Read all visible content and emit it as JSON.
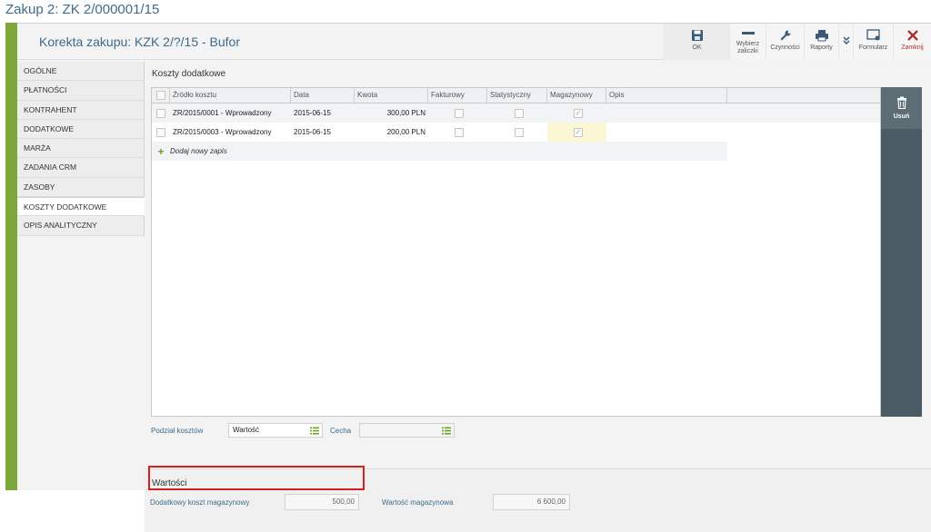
{
  "app": {
    "title": "Zakup 2: ZK 2/000001/15"
  },
  "document": {
    "title": "Korekta zakupu: KZK 2/?/15 - Bufor"
  },
  "toolbar": {
    "ok": "OK",
    "zaliczki_line1": "Wybierz",
    "zaliczki_line2": "zaliczki",
    "czynnosci": "Czynności",
    "raporty": "Raporty",
    "formularz": "Formularz",
    "zamknij": "Zamknij"
  },
  "nav": {
    "items": [
      "OGÓLNE",
      "PŁATNOŚCI",
      "KONTRAHENT",
      "DODATKOWE",
      "MARŻA",
      "ZADANIA CRM",
      "ZASOBY",
      "KOSZTY DODATKOWE",
      "OPIS ANALITYCZNY"
    ],
    "active": "KOSZTY DODATKOWE"
  },
  "section": {
    "title": "Koszty dodatkowe"
  },
  "grid": {
    "columns": [
      "Źródło kosztu",
      "Data",
      "Kwota",
      "Fakturowy",
      "Statystyczny",
      "Magazynowy",
      "Opis"
    ],
    "rows": [
      {
        "source": "ZR/2015/0001 - Wprowadzony",
        "date": "2015-06-15",
        "amount": "300,00 PLN",
        "fakturowy": false,
        "statystyczny": false,
        "magazynowy": true,
        "opis": ""
      },
      {
        "source": "ZR/2015/0003 - Wprowadzony",
        "date": "2015-06-15",
        "amount": "200,00 PLN",
        "fakturowy": false,
        "statystyczny": false,
        "magazynowy": true,
        "opis": ""
      }
    ],
    "add_label": "Dodaj nowy zapis"
  },
  "side": {
    "delete_label": "Usuń"
  },
  "split": {
    "label": "Podział kosztów",
    "value": "Wartość",
    "cecha_label": "Cecha",
    "cecha_value": ""
  },
  "values": {
    "title": "Wartości",
    "extra_cost_label": "Dodatkowy koszt magazynowy",
    "extra_cost_value": "500,00",
    "stock_value_label": "Wartość magazynowa",
    "stock_value_value": "6 600,00"
  },
  "colors": {
    "accent_green": "#7ca83a",
    "title_blue": "#3e6b8a",
    "highlight_red": "#d21f1f",
    "side_panel": "#4a5b63"
  }
}
